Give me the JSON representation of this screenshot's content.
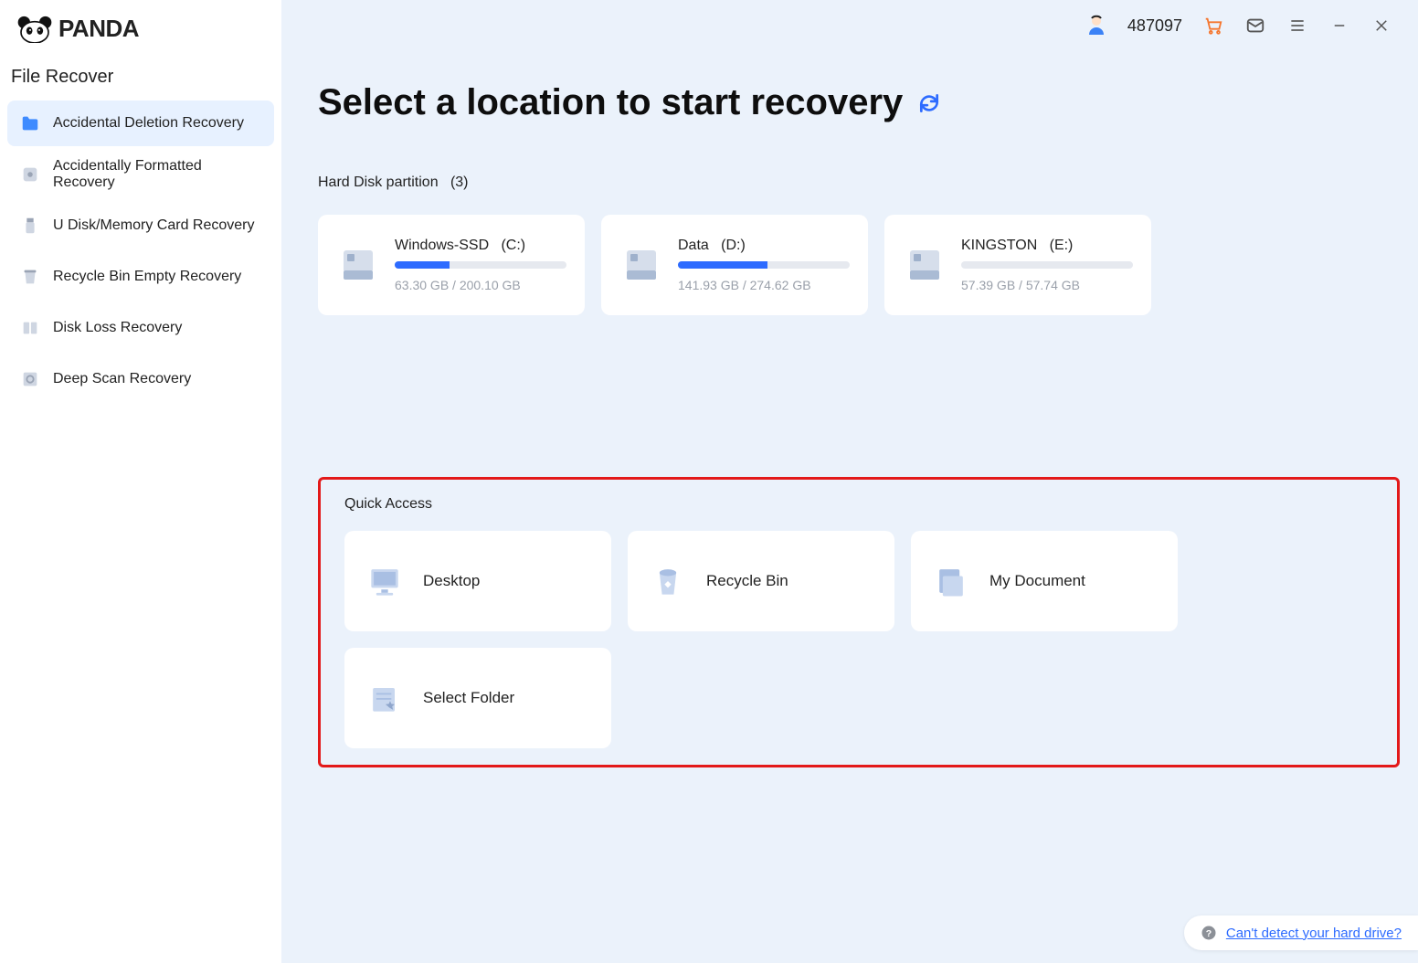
{
  "brand": "PANDA",
  "user_id": "487097",
  "sidebar": {
    "section": "File Recover",
    "items": [
      {
        "label": "Accidental Deletion Recovery",
        "icon": "folder-icon",
        "active": true
      },
      {
        "label": "Accidentally Formatted Recovery",
        "icon": "format-icon",
        "active": false
      },
      {
        "label": "U Disk/Memory Card Recovery",
        "icon": "usb-icon",
        "active": false
      },
      {
        "label": "Recycle Bin Empty Recovery",
        "icon": "bin-icon",
        "active": false
      },
      {
        "label": "Disk Loss Recovery",
        "icon": "diskloss-icon",
        "active": false
      },
      {
        "label": "Deep Scan Recovery",
        "icon": "deepscan-icon",
        "active": false
      }
    ]
  },
  "headline": "Select a location to start recovery",
  "partitions": {
    "heading": "Hard Disk partition",
    "count": "(3)",
    "list": [
      {
        "name": "Windows-SSD",
        "letter": "(C:)",
        "used": "63.30 GB",
        "total": "200.10 GB",
        "pct": 32
      },
      {
        "name": "Data",
        "letter": "(D:)",
        "used": "141.93 GB",
        "total": "274.62 GB",
        "pct": 52
      },
      {
        "name": "KINGSTON",
        "letter": "(E:)",
        "used": "57.39 GB",
        "total": "57.74 GB",
        "pct": 0
      }
    ]
  },
  "quick_access": {
    "heading": "Quick Access",
    "items": [
      {
        "label": "Desktop",
        "icon": "desktop-icon"
      },
      {
        "label": "Recycle Bin",
        "icon": "recyclebin-icon"
      },
      {
        "label": "My Document",
        "icon": "document-icon"
      },
      {
        "label": "Select Folder",
        "icon": "folder-select-icon"
      }
    ]
  },
  "help_link": "Can't detect your hard drive?"
}
